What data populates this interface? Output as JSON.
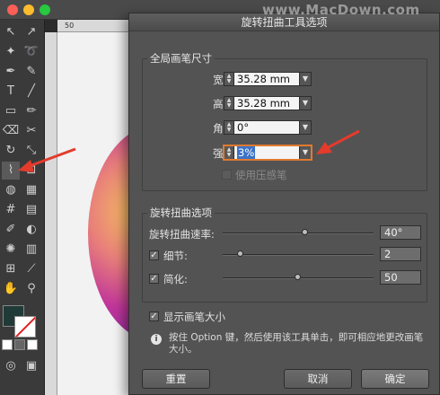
{
  "dialog": {
    "title": "旋转扭曲工具选项",
    "global": {
      "title": "全局画笔尺寸",
      "width_label": "宽度:",
      "width_value": "35.28 mm",
      "height_label": "高度:",
      "height_value": "35.28 mm",
      "angle_label": "角度:",
      "angle_value": "0°",
      "intensity_label": "强度:",
      "intensity_value": "3%",
      "pressure_label": "使用压感笔"
    },
    "twirl": {
      "title": "旋转扭曲选项",
      "rate_label": "旋转扭曲速率:",
      "rate_value": "40°",
      "rate_level": 0.55,
      "detail_label": "细节:",
      "detail_value": "2",
      "detail_level": 0.12,
      "simplify_label": "简化:",
      "simplify_value": "50",
      "simplify_level": 0.5
    },
    "show_brush_label": "显示画笔大小",
    "info_text": "按住 Option 键，然后使用该工具单击，即可相应地更改画笔大小。",
    "reset_label": "重置",
    "cancel_label": "取消",
    "ok_label": "确定"
  },
  "ruler": {
    "label": "50"
  },
  "watermark": "www.MacDown.com",
  "colors": {
    "accent": "#e07a2f",
    "selection": "#3c72c8",
    "arrow": "#e33b2c"
  }
}
